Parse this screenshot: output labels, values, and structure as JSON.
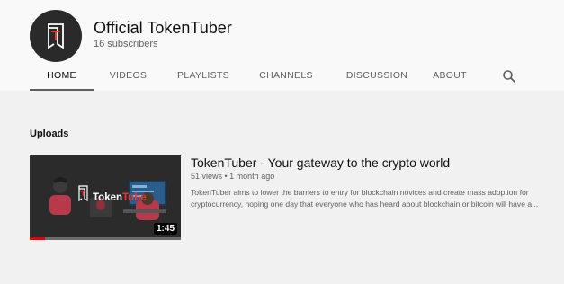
{
  "channel": {
    "name": "Official TokenTuber",
    "subscribers": "16 subscribers"
  },
  "tabs": [
    "HOME",
    "VIDEOS",
    "PLAYLISTS",
    "CHANNELS",
    "DISCUSSION",
    "ABOUT"
  ],
  "active_tab": "HOME",
  "section": {
    "title": "Uploads"
  },
  "video": {
    "title": "TokenTuber - Your gateway to the crypto world",
    "meta": "51 views • 1 month ago",
    "description_lines": [
      "TokenTuber aims to lower the barriers to entry for blockchain novices and create mass adoption for",
      "cryptocurrency, hoping one day that everyone who has heard about blockchain or bitcoin will have a..."
    ],
    "duration": "1:45",
    "watched_fraction": 0.1,
    "thumbnail_text_white": "Token",
    "thumbnail_text_red": "Tube"
  },
  "colors": {
    "header_bg": "#f9f9f9",
    "page_bg": "#f1f1f1",
    "accent_red": "#e00000"
  },
  "icons": {
    "search": "search-icon",
    "logo": "tokentuber-logo-icon"
  }
}
